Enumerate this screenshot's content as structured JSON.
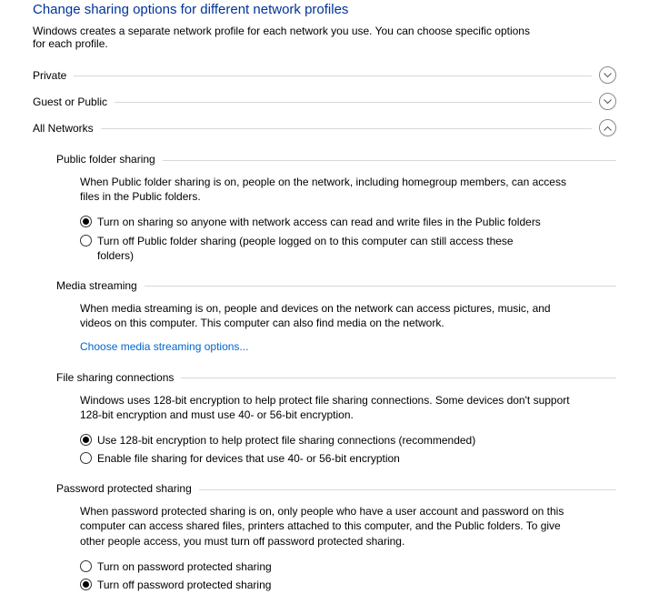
{
  "title": "Change sharing options for different network profiles",
  "description": "Windows creates a separate network profile for each network you use. You can choose specific options for each profile.",
  "profiles": {
    "private": "Private",
    "guest": "Guest or Public",
    "all": "All Networks"
  },
  "sections": {
    "public_folder": {
      "header": "Public folder sharing",
      "desc": "When Public folder sharing is on, people on the network, including homegroup members, can access files in the Public folders.",
      "opt_on": "Turn on sharing so anyone with network access can read and write files in the Public folders",
      "opt_off": "Turn off Public folder sharing (people logged on to this computer can still access these folders)"
    },
    "media": {
      "header": "Media streaming",
      "desc": "When media streaming is on, people and devices on the network can access pictures, music, and videos on this computer. This computer can also find media on the network.",
      "link": "Choose media streaming options..."
    },
    "encryption": {
      "header": "File sharing connections",
      "desc": "Windows uses 128-bit encryption to help protect file sharing connections. Some devices don't support 128-bit encryption and must use 40- or 56-bit encryption.",
      "opt_128": "Use 128-bit encryption to help protect file sharing connections (recommended)",
      "opt_40": "Enable file sharing for devices that use 40- or 56-bit encryption"
    },
    "password": {
      "header": "Password protected sharing",
      "desc": "When password protected sharing is on, only people who have a user account and password on this computer can access shared files, printers attached to this computer, and the Public folders. To give other people access, you must turn off password protected sharing.",
      "opt_on": "Turn on password protected sharing",
      "opt_off": "Turn off password protected sharing"
    }
  }
}
